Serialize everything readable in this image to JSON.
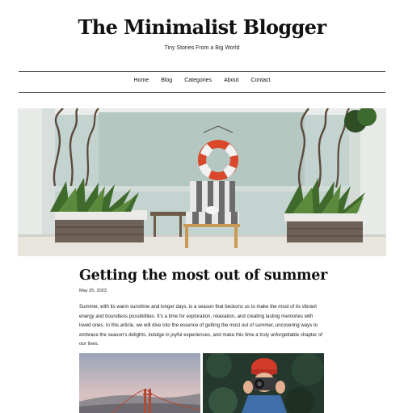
{
  "site": {
    "title": "The Minimalist Blogger",
    "tagline": "Tiny Stories From a Big World"
  },
  "nav": {
    "items": [
      "Home",
      "Blog",
      "Categories",
      "About",
      "Contact"
    ]
  },
  "hero_image": {
    "icon": "patio-lounge-chair-lifebuoy-photo"
  },
  "post": {
    "title": "Getting the most out of summer",
    "date": "May 25, 2023",
    "excerpt": "Summer, with its warm sunshine and longer days, is a season that beckons us to make the most of its vibrant energy and boundless possibilities. It's a time for exploration, relaxation, and creating lasting memories with loved ones. In this article, we will dive into the essence of getting the most out of summer, uncovering ways to embrace the season's delights, indulge in joyful experiences, and make this time a truly unforgettable chapter of our lives.",
    "gallery": [
      {
        "icon": "golden-gate-bridge-photo"
      },
      {
        "icon": "woman-with-camera-photo"
      }
    ]
  },
  "colors": {
    "text": "#111111",
    "rule": "#555555",
    "lifebuoy": "#d9482a"
  }
}
